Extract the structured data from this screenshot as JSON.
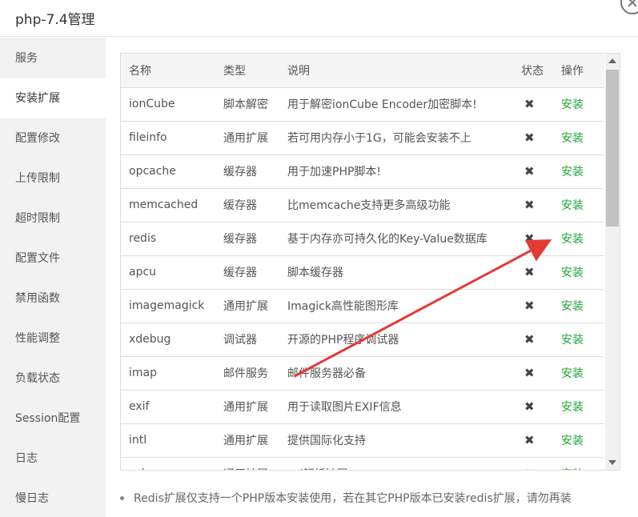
{
  "window": {
    "title": "php-7.4管理"
  },
  "sidebar": {
    "items": [
      {
        "label": "服务"
      },
      {
        "label": "安装扩展"
      },
      {
        "label": "配置修改"
      },
      {
        "label": "上传限制"
      },
      {
        "label": "超时限制"
      },
      {
        "label": "配置文件"
      },
      {
        "label": "禁用函数"
      },
      {
        "label": "性能调整"
      },
      {
        "label": "负载状态"
      },
      {
        "label": "Session配置"
      },
      {
        "label": "日志"
      },
      {
        "label": "慢日志"
      }
    ],
    "active_index": 1
  },
  "table": {
    "headers": {
      "name": "名称",
      "type": "类型",
      "desc": "说明",
      "status": "状态",
      "op": "操作"
    },
    "rows": [
      {
        "name": "ionCube",
        "type": "脚本解密",
        "desc": "用于解密ionCube Encoder加密脚本!",
        "status": "✖",
        "op": "安装"
      },
      {
        "name": "fileinfo",
        "type": "通用扩展",
        "desc": "若可用内存小于1G，可能会安装不上",
        "status": "✖",
        "op": "安装"
      },
      {
        "name": "opcache",
        "type": "缓存器",
        "desc": "用于加速PHP脚本!",
        "status": "✖",
        "op": "安装"
      },
      {
        "name": "memcached",
        "type": "缓存器",
        "desc": "比memcache支持更多高级功能",
        "status": "✖",
        "op": "安装"
      },
      {
        "name": "redis",
        "type": "缓存器",
        "desc": "基于内存亦可持久化的Key-Value数据库",
        "status": "✖",
        "op": "安装"
      },
      {
        "name": "apcu",
        "type": "缓存器",
        "desc": "脚本缓存器",
        "status": "✖",
        "op": "安装"
      },
      {
        "name": "imagemagick",
        "type": "通用扩展",
        "desc": "Imagick高性能图形库",
        "status": "✖",
        "op": "安装"
      },
      {
        "name": "xdebug",
        "type": "调试器",
        "desc": "开源的PHP程序调试器",
        "status": "✖",
        "op": "安装"
      },
      {
        "name": "imap",
        "type": "邮件服务",
        "desc": "邮件服务器必备",
        "status": "✖",
        "op": "安装"
      },
      {
        "name": "exif",
        "type": "通用扩展",
        "desc": "用于读取图片EXIF信息",
        "status": "✖",
        "op": "安装"
      },
      {
        "name": "intl",
        "type": "通用扩展",
        "desc": "提供国际化支持",
        "status": "✖",
        "op": "安装"
      },
      {
        "name": "xsl",
        "type": "通用扩展",
        "desc": "xsl解析扩展",
        "status": "✖",
        "op": "安装"
      }
    ]
  },
  "note": {
    "text": "Redis扩展仅支持一个PHP版本安装使用，若在其它PHP版本已安装redis扩展，请勿再装"
  },
  "colors": {
    "install_green": "#20a53a",
    "annotation_arrow": "#e53935"
  },
  "icons": {
    "status": "x-icon",
    "close": "close-icon"
  }
}
